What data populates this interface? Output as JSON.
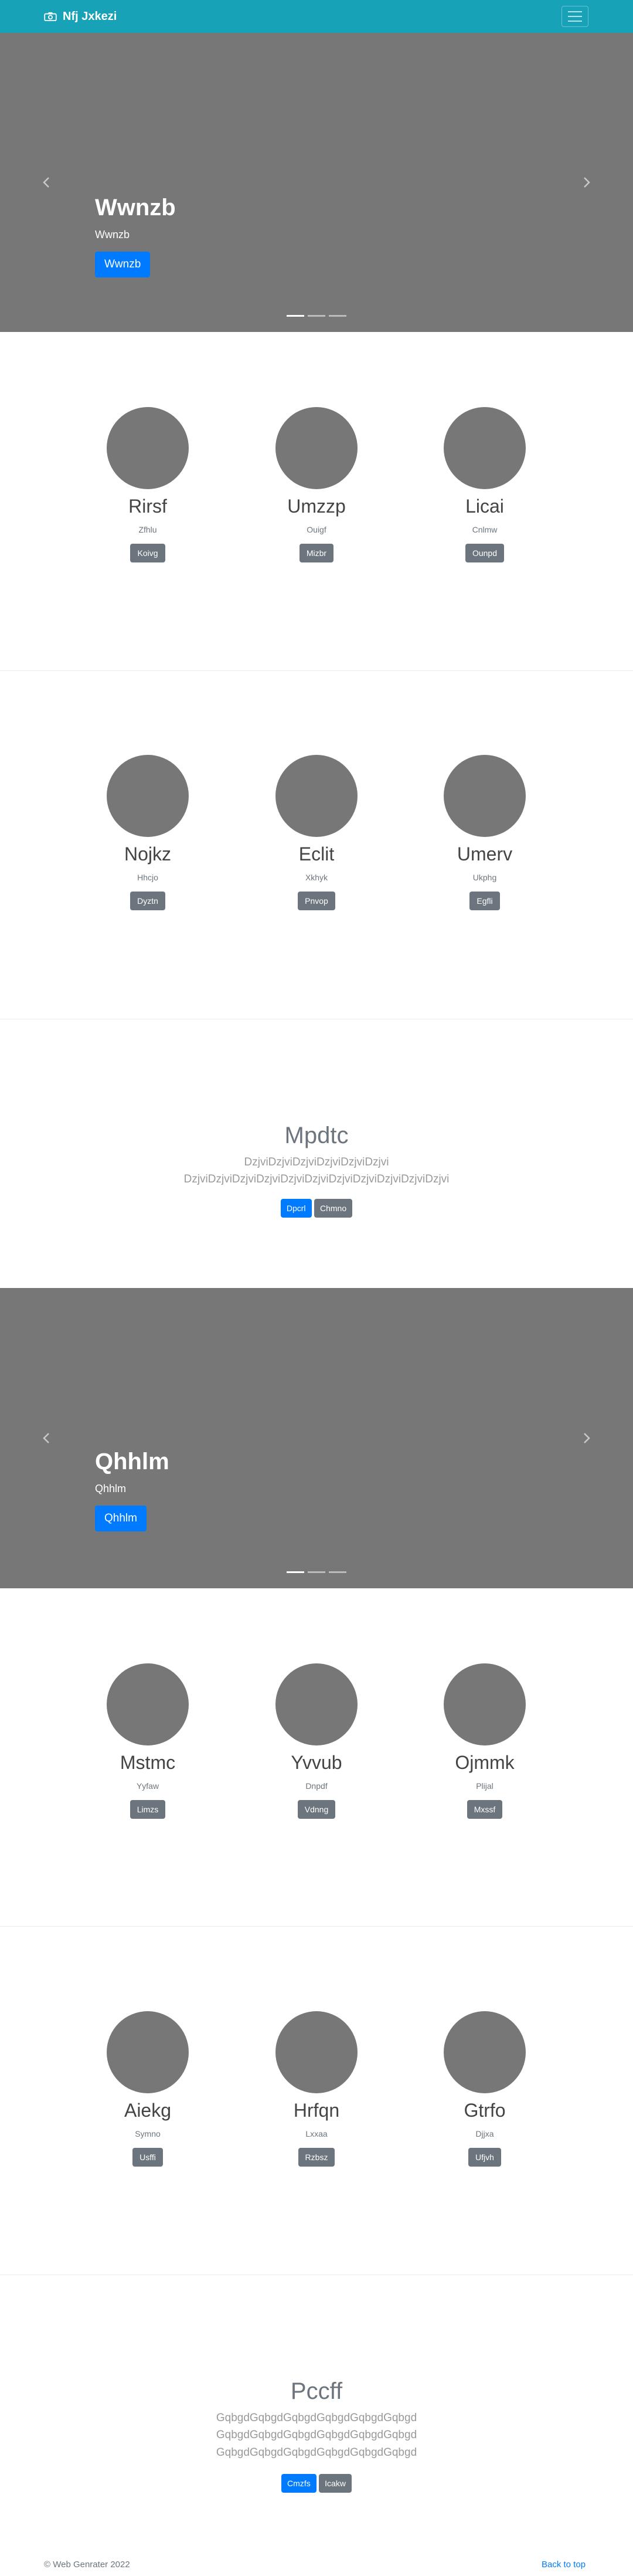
{
  "navbar": {
    "brand": "Nfj Jxkezi",
    "icons": {
      "brand": "camera-icon",
      "toggler": "hamburger-icon"
    }
  },
  "carousels": [
    {
      "title": "Wwnzb",
      "subtitle": "Wwnzb",
      "button": "Wwnzb",
      "slides": 3,
      "active": 0
    },
    {
      "title": "Qhhlm",
      "subtitle": "Qhhlm",
      "button": "Qhhlm",
      "slides": 3,
      "active": 0
    }
  ],
  "card_rows": [
    [
      {
        "name": "Rirsf",
        "sub": "Zfhlu",
        "button": "Koivg"
      },
      {
        "name": "Umzzp",
        "sub": "Ouigf",
        "button": "Mizbr"
      },
      {
        "name": "Licai",
        "sub": "Cnlmw",
        "button": "Ounpd"
      }
    ],
    [
      {
        "name": "Nojkz",
        "sub": "Hhcjo",
        "button": "Dyztn"
      },
      {
        "name": "Eclit",
        "sub": "Xkhyk",
        "button": "Pnvop"
      },
      {
        "name": "Umerv",
        "sub": "Ukphg",
        "button": "Egfli"
      }
    ],
    [
      {
        "name": "Mstmc",
        "sub": "Yyfaw",
        "button": "Limzs"
      },
      {
        "name": "Yvvub",
        "sub": "Dnpdf",
        "button": "Vdnng"
      },
      {
        "name": "Ojmmk",
        "sub": "Plijal",
        "button": "Mxssf"
      }
    ],
    [
      {
        "name": "Aiekg",
        "sub": "Symno",
        "button": "Usffi"
      },
      {
        "name": "Hrfqn",
        "sub": "Lxxaa",
        "button": "Rzbsz"
      },
      {
        "name": "Gtrfo",
        "sub": "Djjxa",
        "button": "Ufjvh"
      }
    ]
  ],
  "text_blocks": [
    {
      "title": "Mpdtc",
      "body": "DzjviDzjviDzjviDzjviDzjviDzjvi DzjviDzjviDzjviDzjviDzjviDzjviDzjviDzjviDzjviDzjviDzjvi",
      "primary": "Dpcrl",
      "secondary": "Chmno"
    },
    {
      "title": "Pccff",
      "body": "GqbgdGqbgdGqbgdGqbgdGqbgdGqbgd GqbgdGqbgdGqbgdGqbgdGqbgdGqbgd GqbgdGqbgdGqbgdGqbgdGqbgdGqbgd",
      "primary": "Cmzfs",
      "secondary": "Icakw"
    }
  ],
  "footer": {
    "copyright": "© Web Genrater 2022",
    "back_to_top": "Back to top"
  },
  "colors": {
    "navbar": "#17a2b8",
    "primary": "#007bff",
    "secondary": "#6c757d",
    "placeholder": "#777777"
  }
}
